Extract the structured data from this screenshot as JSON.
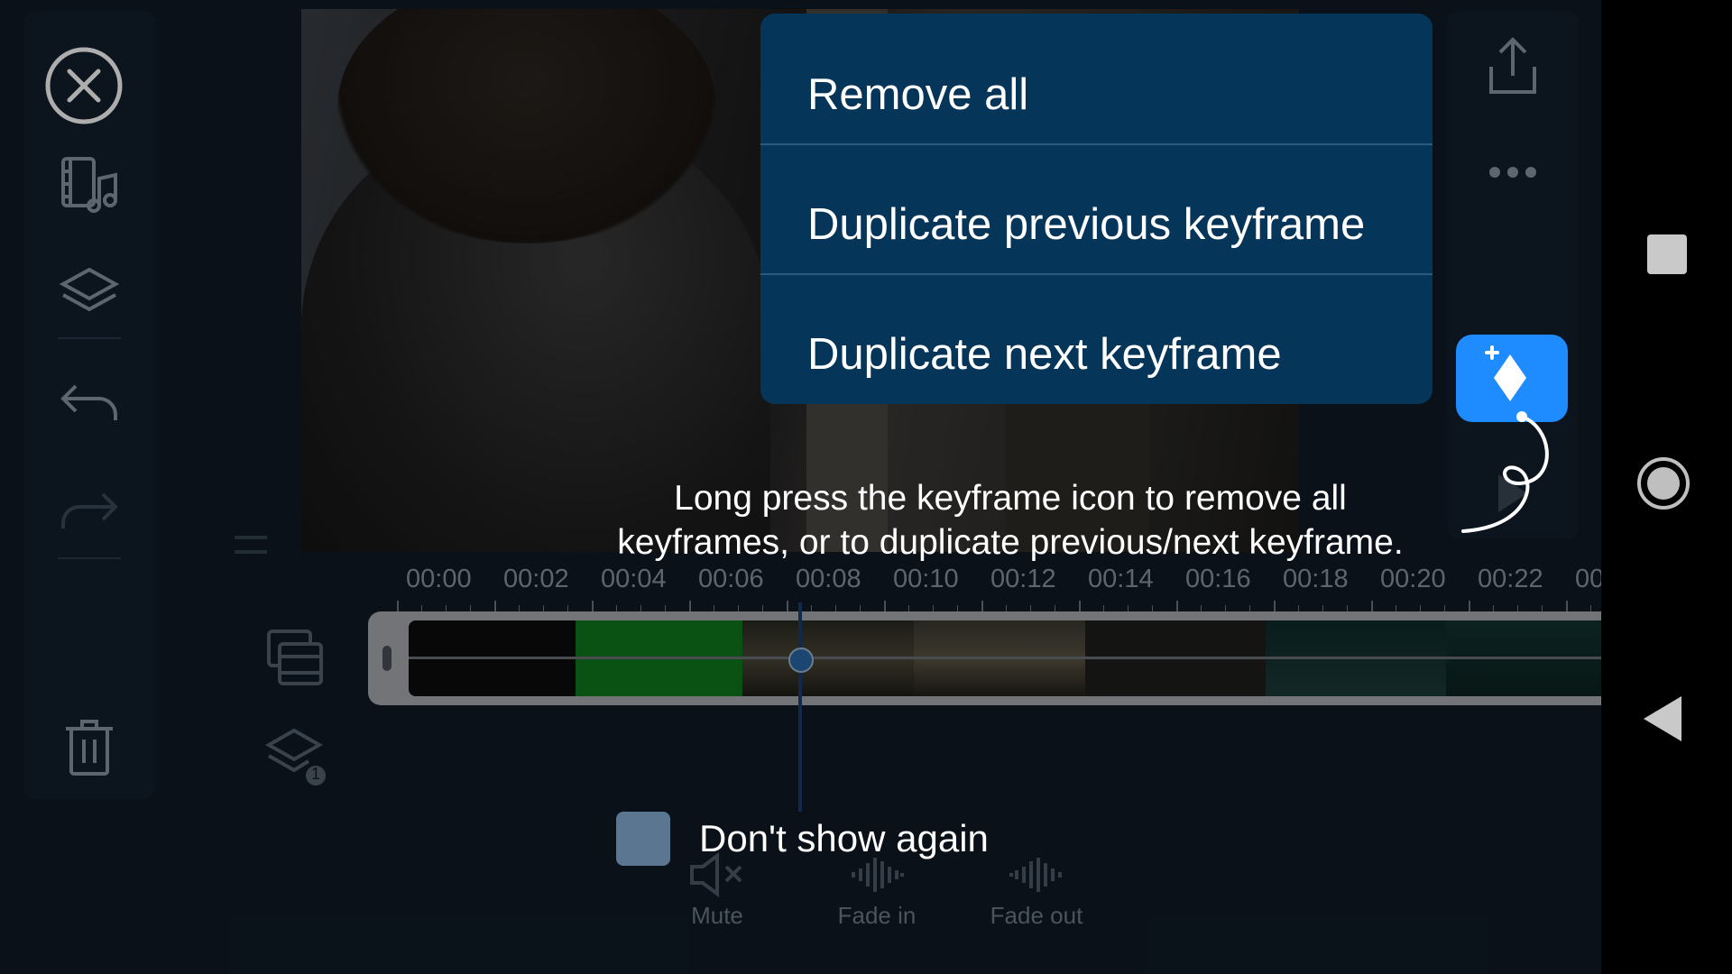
{
  "menu": {
    "remove_all": "Remove all",
    "duplicate_previous": "Duplicate previous keyframe",
    "duplicate_next": "Duplicate next keyframe"
  },
  "hint": {
    "line1": "Long press the keyframe icon to remove all",
    "line2": "keyframes, or to duplicate previous/next keyframe."
  },
  "dont_show_again": "Don't show again",
  "timeline": {
    "ticks": [
      "00:00",
      "00:02",
      "00:04",
      "00:06",
      "00:08",
      "00:10",
      "00:12",
      "00:14",
      "00:16",
      "00:18",
      "00:20",
      "00:22",
      "00"
    ]
  },
  "actions": {
    "mute": "Mute",
    "fade_in": "Fade in",
    "fade_out": "Fade out"
  },
  "layer_badge": "1",
  "colors": {
    "menu_bg": "#06355a",
    "keyframe_button": "#1e8bff",
    "checkbox": "#5b7690"
  },
  "icons": {
    "close": "close-icon",
    "media": "media-icon",
    "layers": "layers-icon",
    "undo": "undo-icon",
    "redo": "redo-icon",
    "delete": "trash-icon",
    "collapse": "double-chevron-left-icon",
    "export": "export-icon",
    "more": "more-icon",
    "keyframe": "keyframe-add-icon"
  }
}
